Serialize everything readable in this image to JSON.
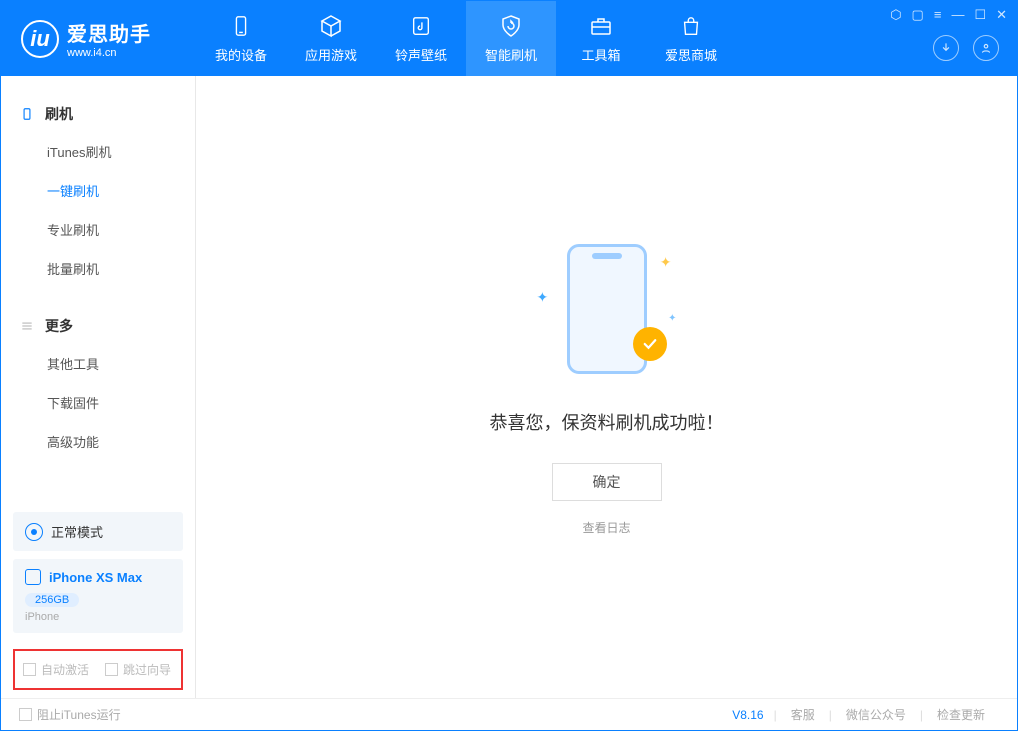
{
  "app": {
    "name": "爱思助手",
    "url": "www.i4.cn"
  },
  "nav": {
    "items": [
      {
        "label": "我的设备"
      },
      {
        "label": "应用游戏"
      },
      {
        "label": "铃声壁纸"
      },
      {
        "label": "智能刷机"
      },
      {
        "label": "工具箱"
      },
      {
        "label": "爱思商城"
      }
    ]
  },
  "sidebar": {
    "section1": {
      "title": "刷机",
      "items": [
        {
          "label": "iTunes刷机"
        },
        {
          "label": "一键刷机"
        },
        {
          "label": "专业刷机"
        },
        {
          "label": "批量刷机"
        }
      ]
    },
    "section2": {
      "title": "更多",
      "items": [
        {
          "label": "其他工具"
        },
        {
          "label": "下载固件"
        },
        {
          "label": "高级功能"
        }
      ]
    },
    "mode_label": "正常模式",
    "device": {
      "name": "iPhone XS Max",
      "capacity": "256GB",
      "type": "iPhone"
    },
    "check1": "自动激活",
    "check2": "跳过向导"
  },
  "main": {
    "success_msg": "恭喜您，保资料刷机成功啦！",
    "ok_button": "确定",
    "log_link": "查看日志"
  },
  "footer": {
    "block_itunes": "阻止iTunes运行",
    "version": "V8.16",
    "links": [
      "客服",
      "微信公众号",
      "检查更新"
    ]
  }
}
